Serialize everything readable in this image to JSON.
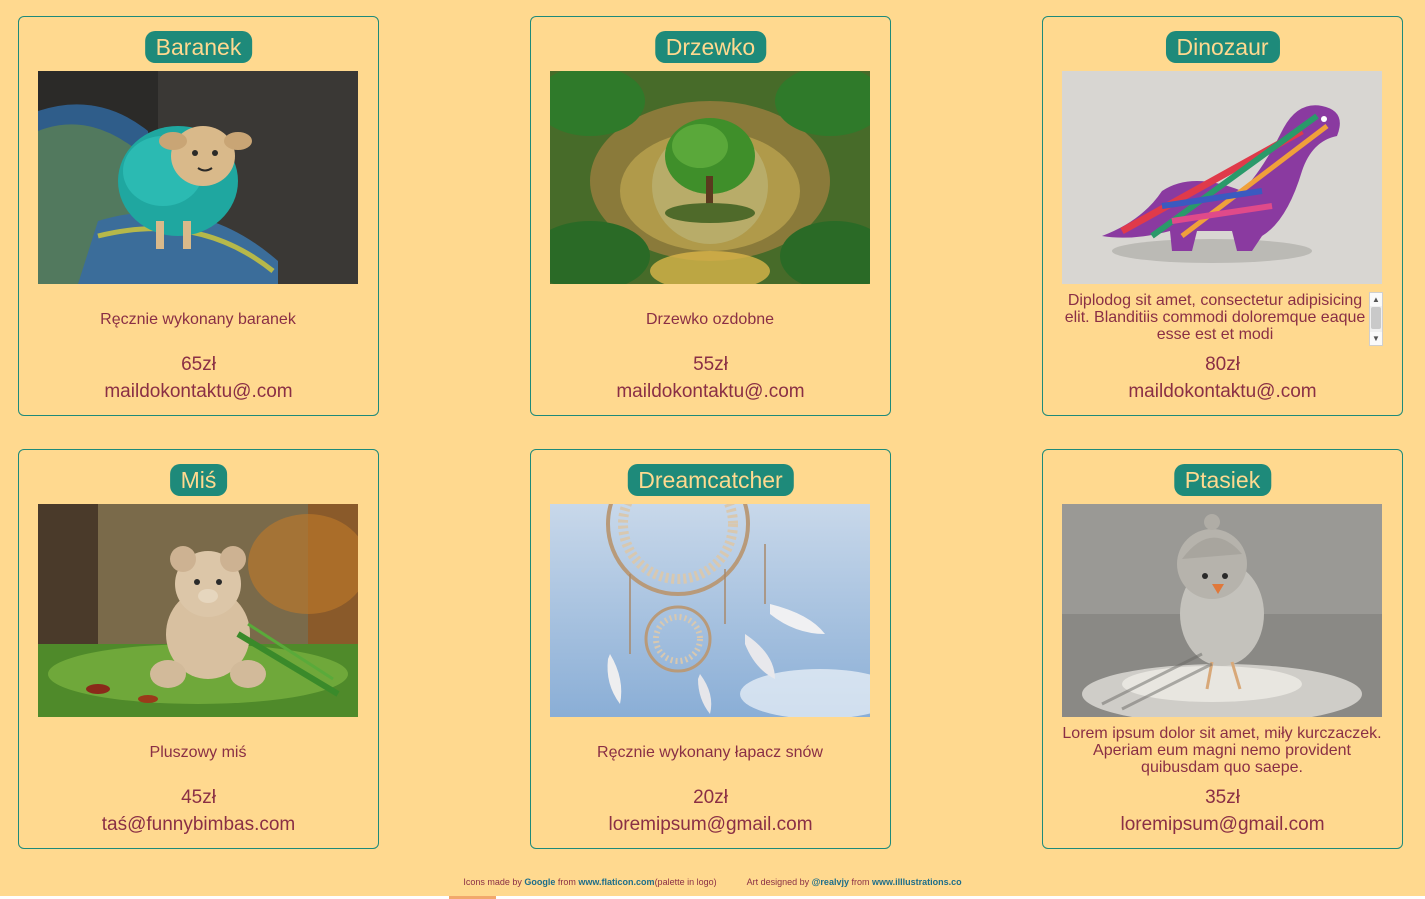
{
  "colors": {
    "background": "#FFD98F",
    "accent": "#1E8A7A",
    "text": "#8A2F45"
  },
  "products": [
    {
      "title": "Baranek",
      "image": "sheep-toy-photo",
      "description": "Ręcznie wykonany baranek",
      "price": "65zł",
      "email": "maildokontaktu@.com"
    },
    {
      "title": "Drzewko",
      "image": "tree-in-glass-photo",
      "description": "Drzewko ozdobne",
      "price": "55zł",
      "email": "maildokontaktu@.com"
    },
    {
      "title": "Dinozaur",
      "image": "striped-dinosaur-toy-photo",
      "description": "Diplodog sit amet, consectetur adipisicing elit. Blanditiis commodi doloremque eaque esse est et modi",
      "price": "80zł",
      "email": "maildokontaktu@.com"
    },
    {
      "title": "Miś",
      "image": "teddy-bear-photo",
      "description": "Pluszowy miś",
      "price": "45zł",
      "email": "taś@funnybimbas.com"
    },
    {
      "title": "Dreamcatcher",
      "image": "dreamcatcher-photo",
      "description": "Ręcznie wykonany łapacz snów",
      "price": "20zł",
      "email": "loremipsum@gmail.com"
    },
    {
      "title": "Ptasiek",
      "image": "felt-bird-photo",
      "description": "Lorem ipsum dolor sit amet, miły kurczaczek. Aperiam eum magni nemo provident quibusdam quo saepe.",
      "price": "35zł",
      "email": "loremipsum@gmail.com"
    }
  ],
  "footer": {
    "icons_prefix": "Icons made by ",
    "icons_author": "Google",
    "icons_from": " from ",
    "icons_site": "www.flaticon.com",
    "icons_note": "(palette in logo)",
    "art_prefix": "Art designed by ",
    "art_author": "@realvjy",
    "art_from": " from ",
    "art_site": "www.illlustrations.co"
  }
}
